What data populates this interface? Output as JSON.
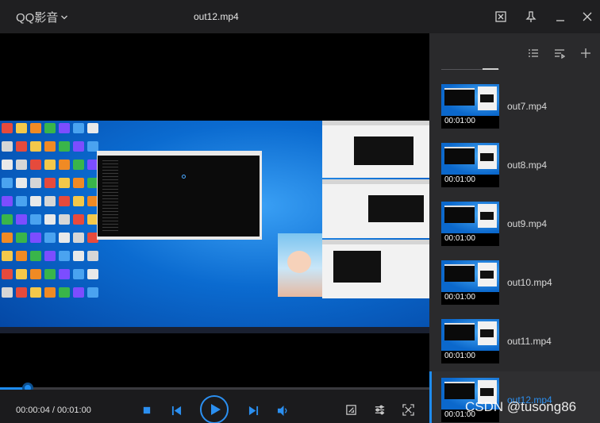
{
  "app": {
    "name": "QQ影音",
    "file_title": "out12.mp4"
  },
  "player": {
    "current_time": "00:00:04",
    "separator": " / ",
    "duration": "00:01:00",
    "progress_fraction": 0.065
  },
  "playlist": {
    "items": [
      {
        "name": "out7.mp4",
        "duration": "00:01:00",
        "active": false
      },
      {
        "name": "out8.mp4",
        "duration": "00:01:00",
        "active": false
      },
      {
        "name": "out9.mp4",
        "duration": "00:01:00",
        "active": false
      },
      {
        "name": "out10.mp4",
        "duration": "00:01:00",
        "active": false
      },
      {
        "name": "out11.mp4",
        "duration": "00:01:00",
        "active": false
      },
      {
        "name": "out12.mp4",
        "duration": "00:01:00",
        "active": true
      }
    ]
  },
  "watermark": "CSDN @tusong86",
  "colors": {
    "accent": "#1e8cf0",
    "background": "#1b1b1d",
    "sidebar": "#2a2a2c"
  }
}
